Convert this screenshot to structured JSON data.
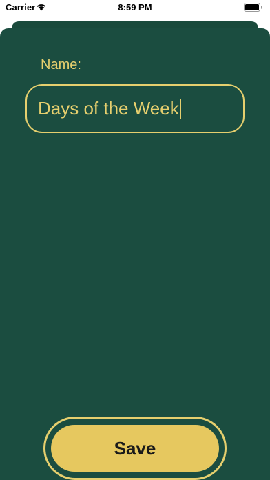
{
  "status_bar": {
    "carrier": "Carrier",
    "time": "8:59 PM"
  },
  "form": {
    "name_label": "Name:",
    "name_value": "Days of the Week"
  },
  "actions": {
    "save_label": "Save"
  },
  "colors": {
    "background": "#1b4d40",
    "accent": "#e6cf6e",
    "button_fill": "#e6c85f"
  },
  "icons": [
    "wifi-icon",
    "battery-icon"
  ]
}
